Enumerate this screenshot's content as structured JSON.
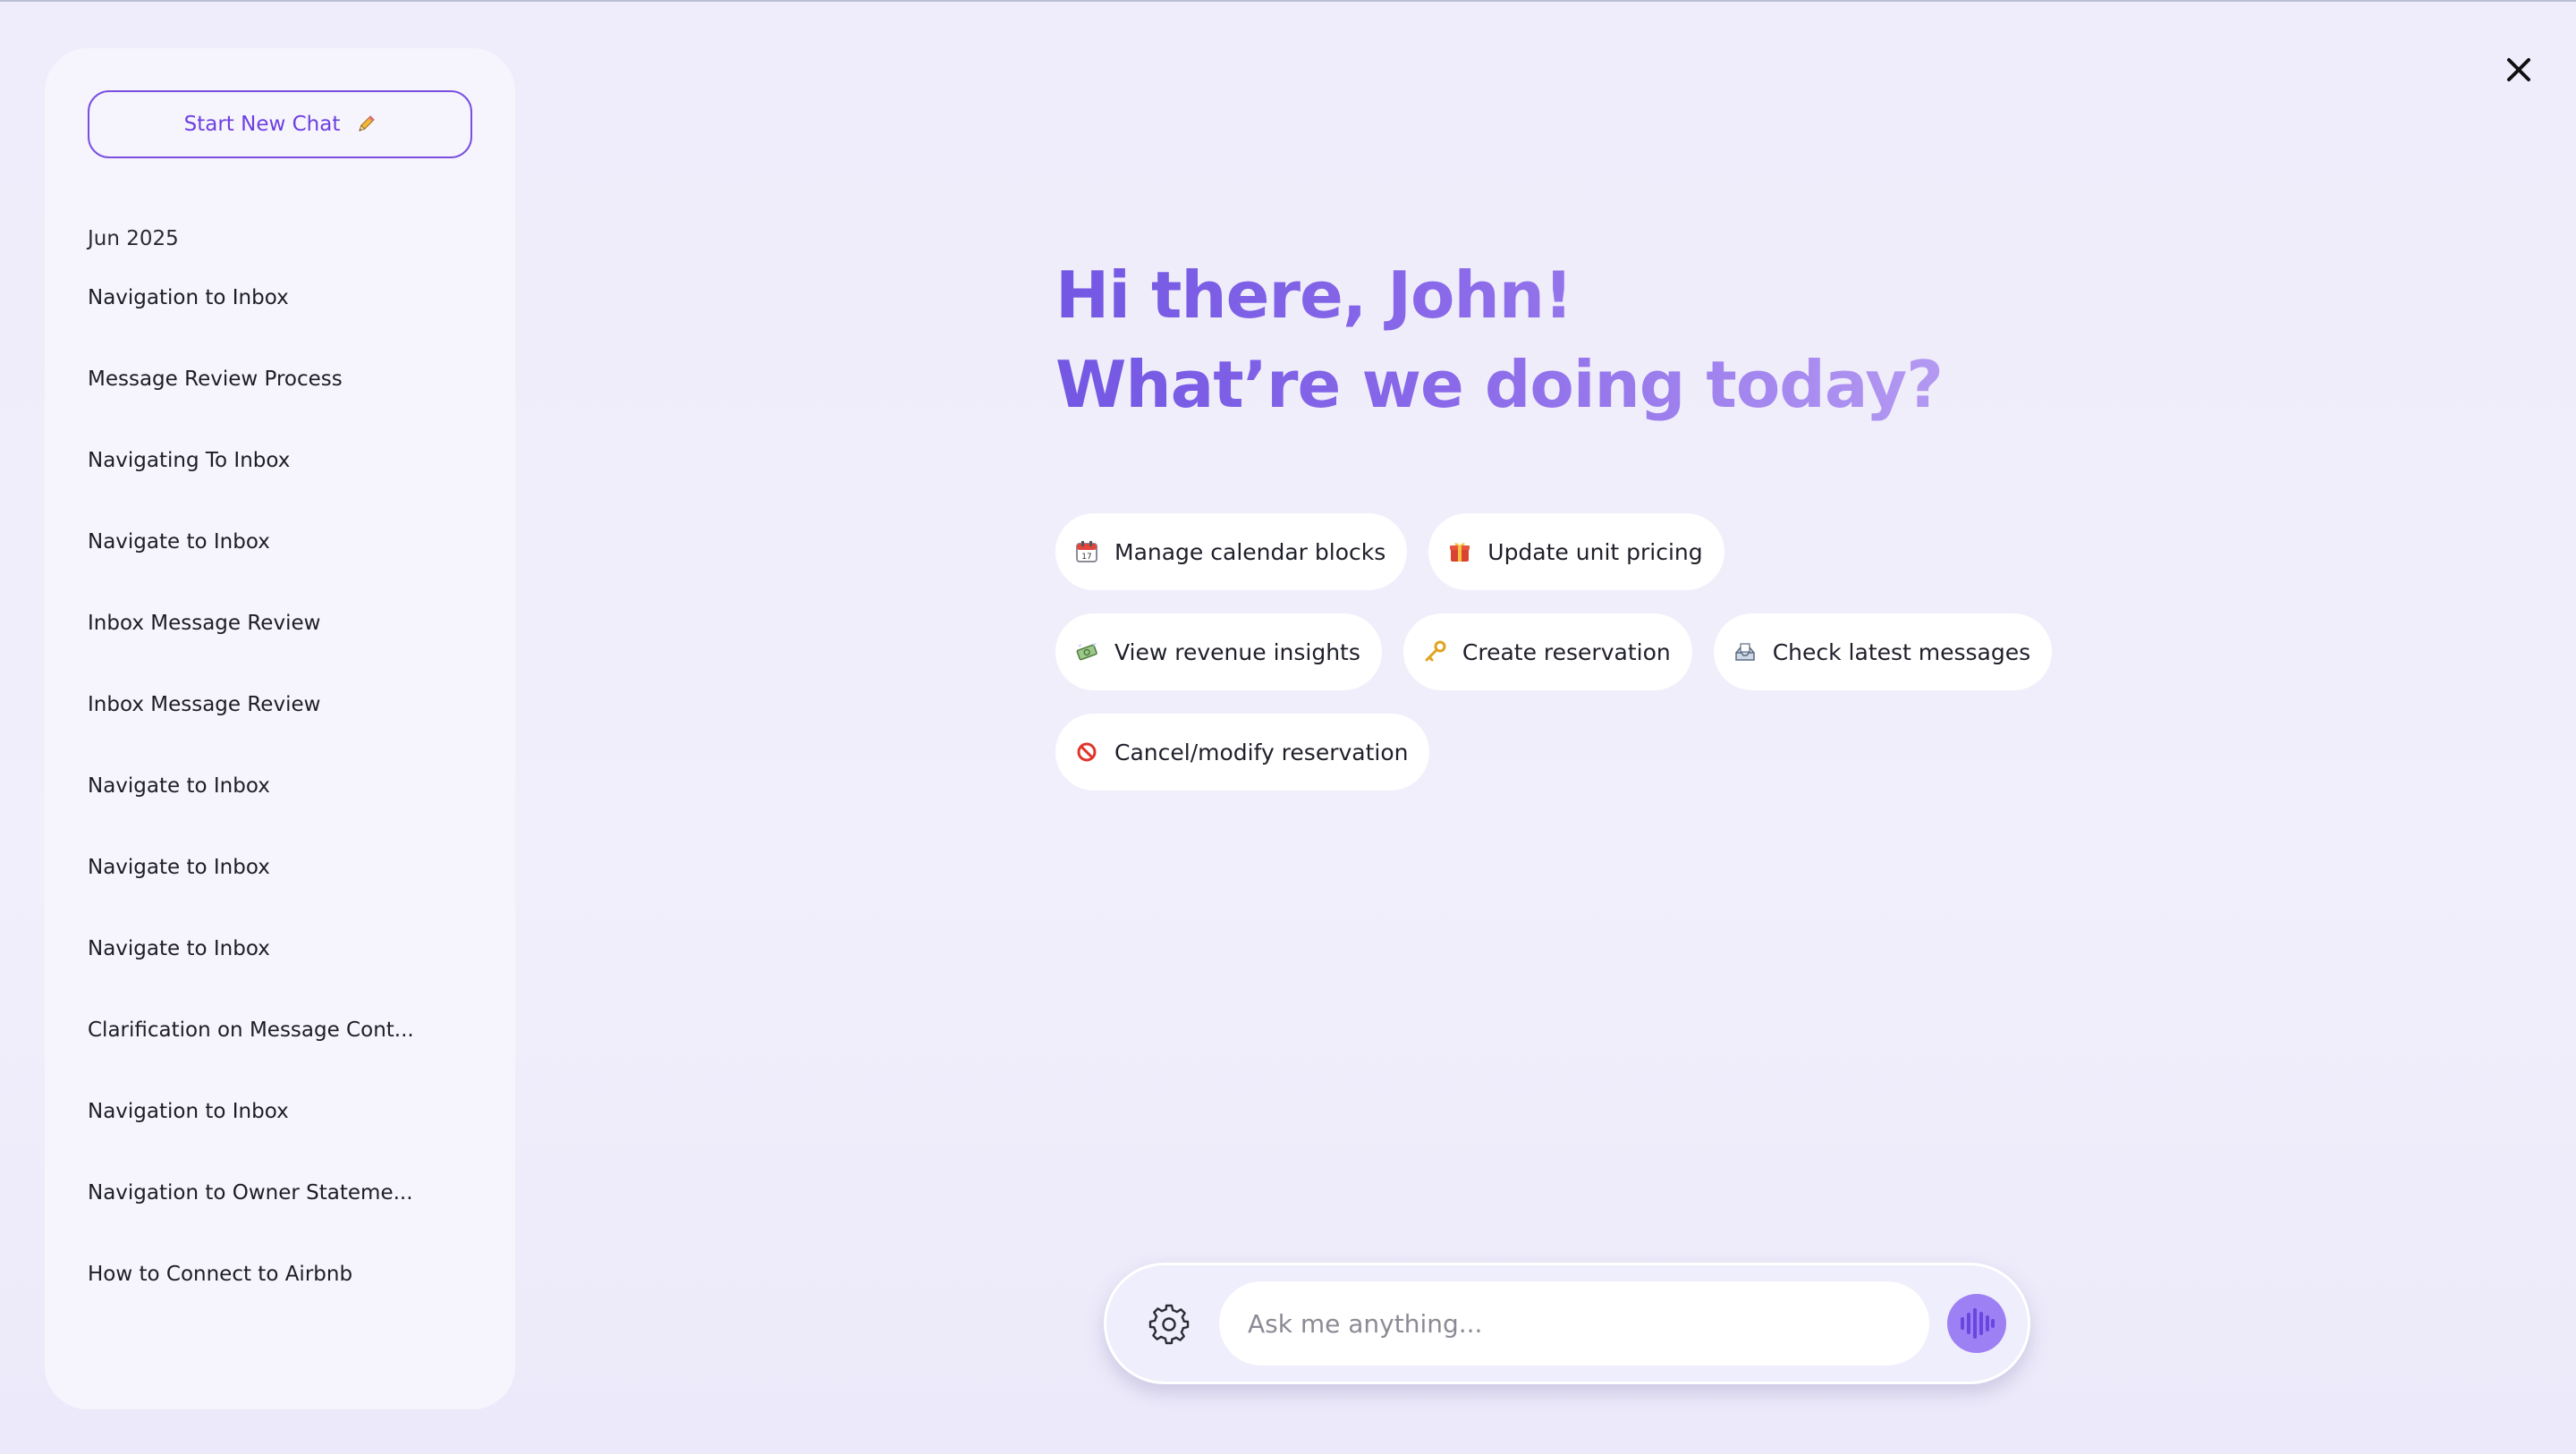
{
  "sidebar": {
    "new_chat_label": "Start New Chat",
    "group_label": "Jun 2025",
    "history": [
      "Navigation to Inbox",
      "Message Review Process",
      "Navigating To Inbox",
      "Navigate to Inbox",
      "Inbox Message Review",
      "Inbox Message Review",
      "Navigate to Inbox",
      "Navigate to Inbox",
      "Navigate to Inbox",
      "Clarification on Message Cont...",
      "Navigation to Inbox",
      "Navigation to Owner Stateme...",
      "How to Connect to Airbnb"
    ]
  },
  "greeting": {
    "line1": "Hi there, John!",
    "line2": "What’re we doing today?"
  },
  "suggestions": [
    {
      "icon": "calendar-icon",
      "label": "Manage calendar blocks"
    },
    {
      "icon": "gift-icon",
      "label": "Update unit pricing"
    },
    {
      "icon": "money-icon",
      "label": "View revenue insights"
    },
    {
      "icon": "key-icon",
      "label": "Create reservation"
    },
    {
      "icon": "inbox-icon",
      "label": "Check latest messages"
    },
    {
      "icon": "prohibited-icon",
      "label": "Cancel/modify reservation"
    }
  ],
  "chat": {
    "placeholder": "Ask me anything..."
  },
  "colors": {
    "accent": "#7a4fe0",
    "voice_button": "#9d80f3",
    "background": "#efecfb"
  }
}
